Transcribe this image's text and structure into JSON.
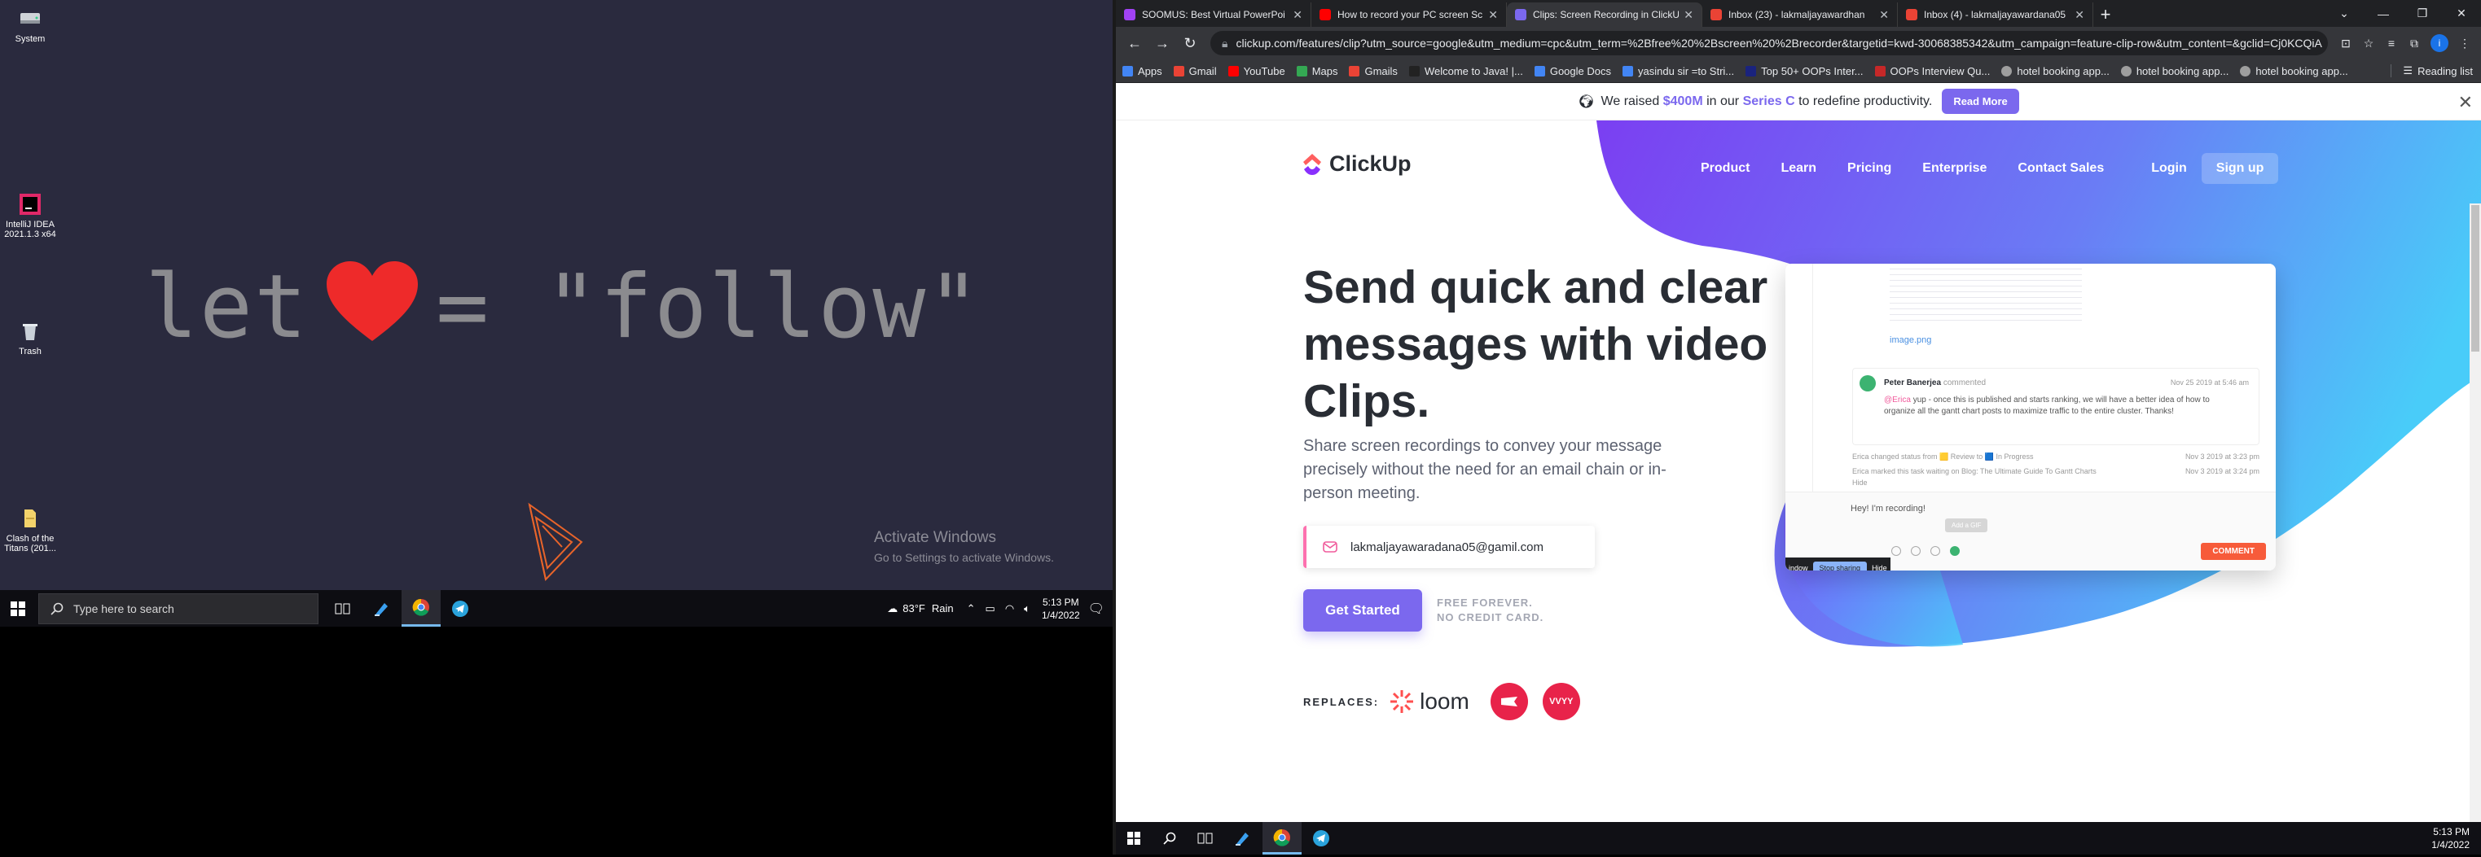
{
  "desktop": {
    "icons": [
      {
        "label": "System",
        "icon": "drive-icon"
      },
      {
        "label": "IntelliJ IDEA 2021.1.3 x64",
        "icon": "intellij-icon"
      },
      {
        "label": "Trash",
        "icon": "trash-icon"
      },
      {
        "label": "Clash of the Titans (201...",
        "icon": "folder-icon"
      }
    ],
    "wallpaper_text": {
      "left": "let",
      "right": "= \"follow\""
    },
    "watermark": {
      "title": "Activate Windows",
      "subtitle": "Go to Settings to activate Windows."
    }
  },
  "taskbar_left": {
    "search_placeholder": "Type here to search",
    "weather": {
      "temp": "83°F",
      "condition": "Rain"
    },
    "time": "5:13 PM",
    "date": "1/4/2022"
  },
  "browser": {
    "tabs": [
      {
        "label": "SOOMUS: Best Virtual PowerPoi",
        "color": "#a142f4"
      },
      {
        "label": "How to record your PC screen Sc",
        "color": "#ff0000"
      },
      {
        "label": "Clips: Screen Recording in ClickUp",
        "color": "#7b68ee",
        "active": true
      },
      {
        "label": "Inbox (23) - lakmaljayawardhan",
        "color": "#ea4335"
      },
      {
        "label": "Inbox (4) - lakmaljayawardana05",
        "color": "#ea4335"
      }
    ],
    "url": "clickup.com/features/clip?utm_source=google&utm_medium=cpc&utm_term=%2Bfree%20%2Bscreen%20%2Brecorder&targetid=kwd-30068385342&utm_campaign=feature-clip-row&utm_content=&gclid=Cj0KCQiA",
    "profile_initial": "i",
    "bookmarks": [
      {
        "label": "Apps",
        "color": "#4285f4"
      },
      {
        "label": "Gmail",
        "color": "#ea4335"
      },
      {
        "label": "YouTube",
        "color": "#ff0000"
      },
      {
        "label": "Maps",
        "color": "#34a853"
      },
      {
        "label": "Gmails",
        "color": "#ea4335"
      },
      {
        "label": "Welcome to Java! |...",
        "color": "#222222"
      },
      {
        "label": "Google Docs",
        "color": "#4285f4"
      },
      {
        "label": "yasindu sir =to Stri...",
        "color": "#4285f4"
      },
      {
        "label": "Top 50+ OOPs Inter...",
        "color": "#1a237e"
      },
      {
        "label": "OOPs Interview Qu...",
        "color": "#c62828"
      },
      {
        "label": "hotel booking app...",
        "color": "#9e9e9e"
      },
      {
        "label": "hotel booking app...",
        "color": "#9e9e9e"
      },
      {
        "label": "hotel booking app...",
        "color": "#9e9e9e"
      }
    ],
    "reading_list": "Reading list"
  },
  "page": {
    "banner": {
      "pre": "We raised",
      "amount": "$400M",
      "mid": "in our",
      "series": "Series C",
      "post": "to redefine productivity.",
      "cta": "Read More"
    },
    "logo": "ClickUp",
    "nav": [
      "Product",
      "Learn",
      "Pricing",
      "Enterprise",
      "Contact Sales",
      "Login"
    ],
    "signup": "Sign up",
    "headline": "Send quick and clear messages with video Clips.",
    "subtext": "Share screen recordings to convey your message precisely without the need for an email chain or in-person meeting.",
    "email_value": "lakmaljayawaradana05@gamil.com",
    "cta": "Get Started",
    "free_line1": "FREE FOREVER.",
    "free_line2": "NO CREDIT CARD.",
    "replaces_label": "REPLACES:",
    "loom": "loom",
    "vidyard": "VVYY"
  },
  "card": {
    "image_name": "image.png",
    "author": "Peter Banerjea",
    "commented": "commented",
    "date": "Nov 25 2019 at 5:46 am",
    "mention": "@Erica",
    "body": "yup - once this is published and starts ranking, we will have a better idea of how to organize all the gantt chart posts to maximize traffic to the entire cluster. Thanks!",
    "activity1": "Erica changed status from 🟨 Review to 🟦 In Progress",
    "activity1_date": "Nov 3 2019 at 3:23 pm",
    "activity2": "Erica marked this task waiting on Blog: The Ultimate Guide To Gantt Charts",
    "activity2_date": "Nov 3 2019 at 3:24 pm",
    "hide": "Hide",
    "recording": "Hey! I'm recording!",
    "tooltip": "Add a GIF",
    "comment_btn": "COMMENT",
    "stop_label": "Stop sharing",
    "hide_label": "Hide",
    "window_label": "indow"
  },
  "taskbar_right": {
    "time": "5:13 PM",
    "date": "1/4/2022"
  }
}
